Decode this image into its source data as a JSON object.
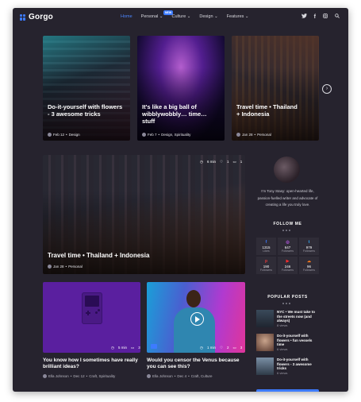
{
  "header": {
    "logo": "Gorgo",
    "nav": [
      {
        "label": "Home",
        "active": true
      },
      {
        "label": "Personal",
        "caret": true
      },
      {
        "label": "Culture",
        "caret": true
      },
      {
        "label": "Design",
        "caret": true
      },
      {
        "label": "Features",
        "caret": true
      }
    ],
    "badge": "NEW",
    "social_icons": [
      "twitter-icon",
      "facebook-icon",
      "instagram-icon",
      "search-icon"
    ]
  },
  "featured": [
    {
      "title": "Do-it-yourself with flowers - 3 awesome tricks",
      "date": "Feb 12",
      "category": "Design"
    },
    {
      "title": "It's like a big ball of wibblywobbly… time… stuff",
      "date": "Feb 7",
      "category": "Design, Spirituality"
    },
    {
      "title": "Travel time • Thailand + Indonesia",
      "date": "Jan 28",
      "category": "Personal"
    }
  ],
  "main_post": {
    "title": "Travel time • Thailand + Indonesia",
    "date": "Jan 28",
    "category": "Personal",
    "read_time": "6 min",
    "likes": "1",
    "comments": "1"
  },
  "grid_posts": [
    {
      "title": "You know how I sometimes have really brilliant ideas?",
      "author": "Ella Johnson",
      "date": "Dec 12",
      "category": "Craft, Spirituality",
      "read_time": "5 min",
      "comments": "3"
    },
    {
      "title": "Would you censor the Venus because you can see this?",
      "author": "Ella Johnson",
      "date": "Dec 4",
      "category": "Craft, Culture",
      "read_time": "1 min",
      "likes": "2",
      "comments": "3"
    }
  ],
  "sidebar": {
    "bio": "I'm Tony Stasy: open-hearted life, passion-fuelled writer and advocate of creating a life you truly love.",
    "follow_title": "FOLLOW ME",
    "social": [
      {
        "icon": "facebook-icon",
        "glyph": "f",
        "color": "#3d7bff",
        "count": "1315",
        "unit": "Likes"
      },
      {
        "icon": "instagram-icon",
        "glyph": "◎",
        "color": "#c05cf0",
        "count": "647",
        "unit": "Followers"
      },
      {
        "icon": "twitter-icon",
        "glyph": "t",
        "color": "#2fa8f5",
        "count": "979",
        "unit": "Followers"
      },
      {
        "icon": "pinterest-icon",
        "glyph": "p",
        "color": "#e23a3a",
        "count": "190",
        "unit": "Followers"
      },
      {
        "icon": "youtube-icon",
        "glyph": "▶",
        "color": "#ff2d2d",
        "count": "246",
        "unit": "Followers"
      },
      {
        "icon": "soundcloud-icon",
        "glyph": "☁",
        "color": "#ff7a1a",
        "count": "96",
        "unit": "Followers"
      }
    ],
    "popular_title": "POPULAR POSTS",
    "popular": [
      {
        "title": "NYC • We must take to the streets now (and always)",
        "views": "8 views"
      },
      {
        "title": "Do-it-yourself with flowers • fun vessels time",
        "views": "6 views"
      },
      {
        "title": "Do-it-yourself with flowers - 3 awesome tricks",
        "views": "6 views"
      }
    ]
  }
}
